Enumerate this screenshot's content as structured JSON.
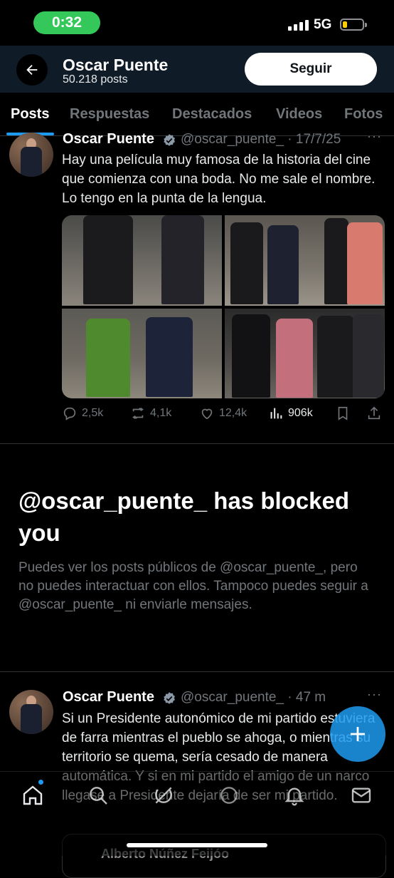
{
  "status_bar": {
    "time": "0:32",
    "network": "5G"
  },
  "header": {
    "name": "Oscar Puente",
    "post_count": "50.218 posts",
    "follow_label": "Seguir"
  },
  "tabs": [
    "Posts",
    "Respuestas",
    "Destacados",
    "Videos",
    "Fotos"
  ],
  "tweet1": {
    "name": "Oscar Puente",
    "handle_date": "@oscar_puente_ · 17/7/25",
    "text": "Hay una película muy famosa de la historia del cine que comienza con una boda. No me sale el nombre. Lo tengo en la punta de la lengua.",
    "replies": "2,5k",
    "reposts": "4,1k",
    "likes": "12,4k",
    "views": "906k"
  },
  "block_notice": {
    "title": "@oscar_puente_ has blocked you",
    "text": "Puedes ver los posts públicos de @oscar_puente_, pero no puedes interactuar con ellos. Tampoco puedes seguir a @oscar_puente_ ni enviarle mensajes."
  },
  "tweet2": {
    "name": "Oscar Puente",
    "handle_date": "@oscar_puente_ · 47 m",
    "text": "Si un Presidente autonómico de mi partido estuviera de farra mientras el pueblo se ahoga, o mientras su territorio se quema, sería cesado de manera automática. Y si en mi partido el amigo de un narco llegase a Presidente dejaría de ser mi partido."
  },
  "quoted": {
    "author": "Alberto Núñez Feijóo"
  },
  "colors": {
    "accent": "#1d9bf0",
    "time_pill": "#34c759",
    "background": "#000000"
  }
}
